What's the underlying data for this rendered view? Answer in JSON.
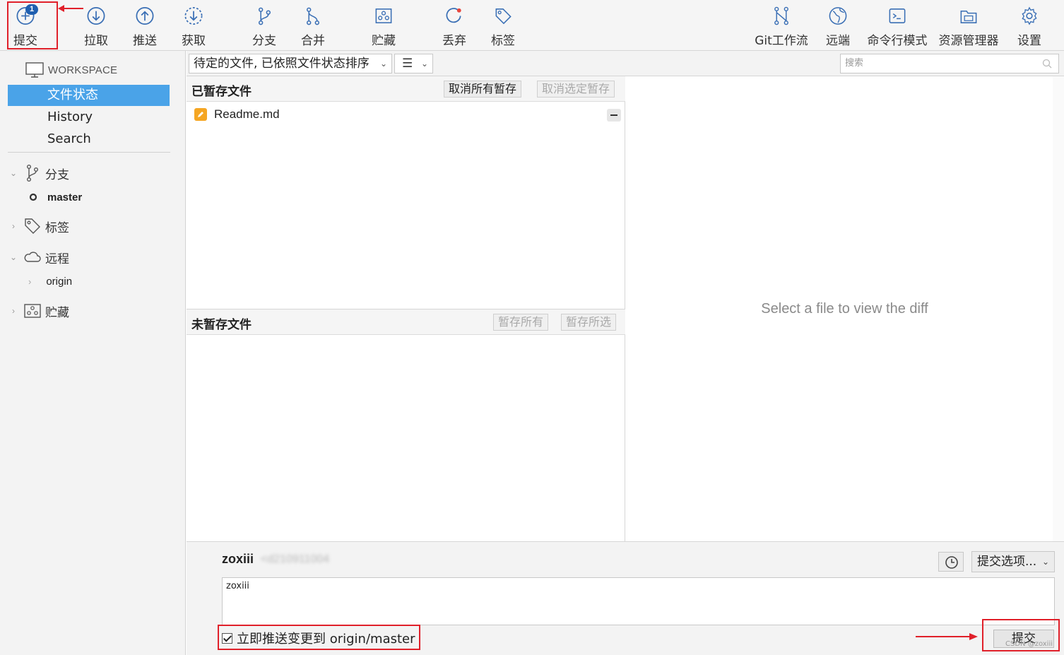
{
  "toolbar": {
    "commit": {
      "label": "提交",
      "badge": "1"
    },
    "pull": "拉取",
    "push": "推送",
    "fetch": "获取",
    "branch": "分支",
    "merge": "合并",
    "stash": "贮藏",
    "discard": "丢弃",
    "tag": "标签",
    "gitflow": "Git工作流",
    "remote": "远端",
    "terminal": "命令行模式",
    "explorer": "资源管理器",
    "settings": "设置"
  },
  "sidebar": {
    "workspace": "WORKSPACE",
    "items": [
      "文件状态",
      "History",
      "Search"
    ],
    "branches": {
      "label": "分支",
      "items": [
        "master"
      ]
    },
    "tags": {
      "label": "标签"
    },
    "remotes": {
      "label": "远程",
      "items": [
        "origin"
      ]
    },
    "stashes": {
      "label": "贮藏"
    }
  },
  "filter": {
    "sort": "待定的文件, 已依照文件状态排序",
    "view": "☰",
    "search_placeholder": "搜索"
  },
  "staged": {
    "title": "已暂存文件",
    "unstage_all": "取消所有暂存",
    "unstage_selected": "取消选定暂存",
    "files": [
      "Readme.md"
    ]
  },
  "unstaged": {
    "title": "未暂存文件",
    "stage_all": "暂存所有",
    "stage_selected": "暂存所选"
  },
  "diff": {
    "placeholder": "Select a file to view the diff"
  },
  "commit": {
    "author": "zoxiii",
    "email": "<d210911004",
    "message": "zoxiii",
    "options": "提交选项...",
    "push_label": "立即推送变更到 origin/master",
    "button": "提交"
  },
  "watermark": "CSDN @zoxiii",
  "colors": {
    "accent": "#4aa3e8",
    "annotation": "#e0202a",
    "badge": "#1f5fb0",
    "file_modified": "#f5a623"
  }
}
